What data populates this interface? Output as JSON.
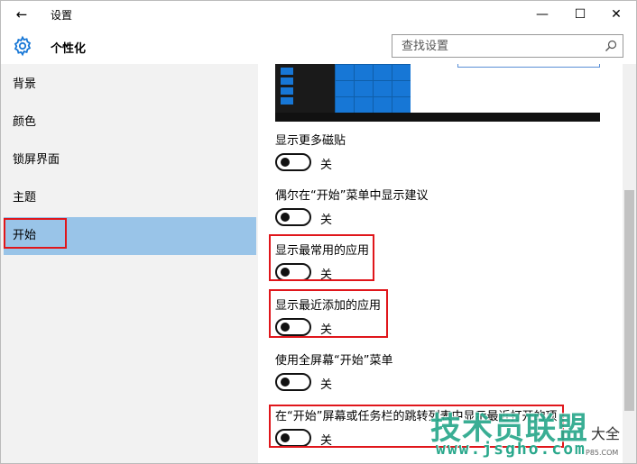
{
  "window": {
    "title": "设置",
    "back_glyph": "←",
    "min_glyph": "—",
    "max_glyph": "☐",
    "close_glyph": "✕"
  },
  "header": {
    "icon": "gear-icon",
    "title": "个性化",
    "search_placeholder": "查找设置",
    "search_value": ""
  },
  "sidebar": {
    "items": [
      {
        "label": "背景"
      },
      {
        "label": "颜色"
      },
      {
        "label": "锁屏界面"
      },
      {
        "label": "主题"
      },
      {
        "label": "开始",
        "active": true
      }
    ]
  },
  "settings": [
    {
      "label": "显示更多磁贴",
      "state": "关",
      "on": false
    },
    {
      "label": "偶尔在“开始”菜单中显示建议",
      "state": "关",
      "on": false
    },
    {
      "label": "显示最常用的应用",
      "state": "关",
      "on": false
    },
    {
      "label": "显示最近添加的应用",
      "state": "关",
      "on": false
    },
    {
      "label": "使用全屏幕“开始”菜单",
      "state": "关",
      "on": false
    },
    {
      "label": "在“开始”屏幕或任务栏的跳转列表中显示最近打开的项",
      "state": "关",
      "on": false
    }
  ],
  "watermark": {
    "main": "技术员联盟",
    "side": "大全",
    "url": "www.jsgho.com",
    "url_small": "P85.COM"
  },
  "colors": {
    "accent": "#1777d6",
    "active_nav": "#99c4e8",
    "highlight": "#e0161b",
    "watermark": "#2aa88c"
  }
}
